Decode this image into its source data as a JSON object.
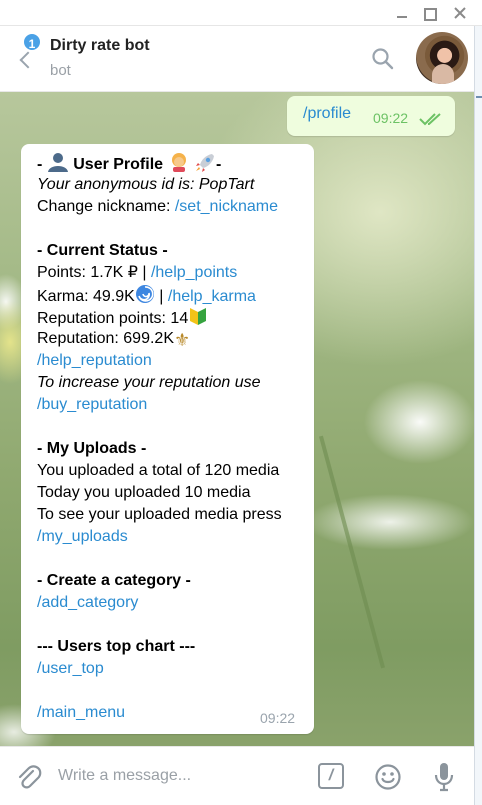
{
  "header": {
    "unread_count": "1",
    "title": "Dirty rate bot",
    "subtitle": "bot"
  },
  "outgoing": {
    "text": "/profile",
    "time": "09:22"
  },
  "incoming": {
    "profile_heading_prefix": "- ",
    "profile_heading_text": "User Profile",
    "profile_heading_suffix": "-",
    "anon_id": "Your anonymous id is: PopTart",
    "change_nickname_label": "Change nickname: ",
    "change_nickname_link": "/set_nickname",
    "status_heading": "- Current Status -",
    "points_label": "Points: 1.7K ₽ | ",
    "points_link": "/help_points",
    "karma_label": "Karma: 49.9K",
    "karma_sep": " | ",
    "karma_link": "/help_karma",
    "rep_points_label": "Reputation points: 14",
    "reputation_label": "Reputation: 699.2K",
    "help_reputation_link": "/help_reputation",
    "increase_rep_text": "To increase your reputation use",
    "buy_reputation_link": "/buy_reputation",
    "uploads_heading": "- My Uploads -",
    "uploads_total": "You uploaded a total of 120 media",
    "uploads_today": "Today you uploaded 10 media",
    "uploads_see": "To see your uploaded media press",
    "my_uploads_link": "/my_uploads",
    "category_heading": "- Create a category -",
    "add_category_link": "/add_category",
    "top_chart_heading": "--- Users top chart ---",
    "user_top_link": "/user_top",
    "main_menu_link": "/main_menu",
    "time": "09:22"
  },
  "compose": {
    "placeholder": "Write a message..."
  },
  "icons": {
    "back": "chevron-left-icon",
    "search": "search-icon",
    "attach": "paperclip-icon",
    "commands": "slash-command-icon",
    "emoji": "smiley-icon",
    "mic": "microphone-icon"
  },
  "colors": {
    "link": "#2a8bd0",
    "outgoing_bubble": "#effdde",
    "check": "#6cc264",
    "badge": "#4aa1e6"
  }
}
